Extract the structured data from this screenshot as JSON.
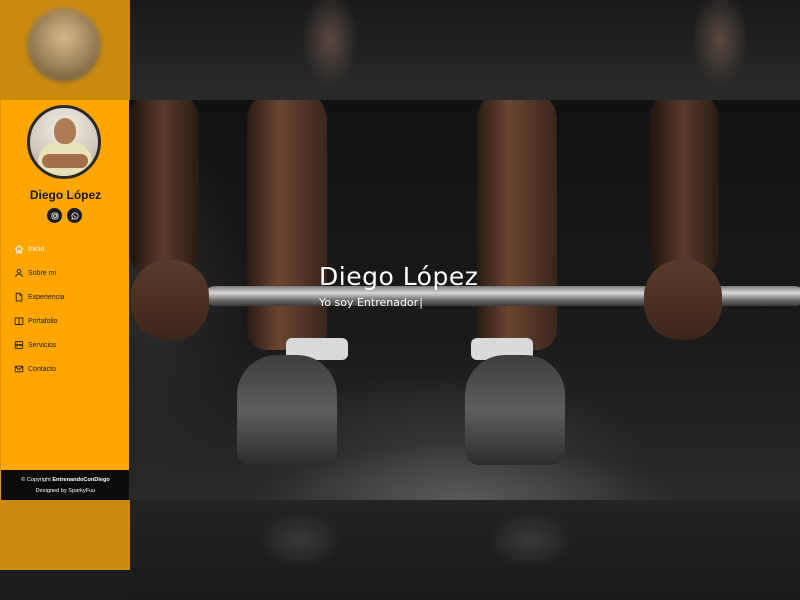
{
  "profile": {
    "name": "Diego López",
    "socials": [
      {
        "icon": "instagram-icon"
      },
      {
        "icon": "whatsapp-icon"
      }
    ]
  },
  "nav": {
    "items": [
      {
        "label": "Inicio",
        "icon": "home-icon",
        "active": true
      },
      {
        "label": "Sobre mi",
        "icon": "user-icon",
        "active": false
      },
      {
        "label": "Experiencia",
        "icon": "document-icon",
        "active": false
      },
      {
        "label": "Portafolio",
        "icon": "book-icon",
        "active": false
      },
      {
        "label": "Servicios",
        "icon": "server-icon",
        "active": false
      },
      {
        "label": "Contacto",
        "icon": "envelope-icon",
        "active": false
      }
    ]
  },
  "footer": {
    "copyright_prefix": "© Copyright ",
    "brand": "EntrenandoConDiego",
    "designed_by": "Designed by SparkyFuu"
  },
  "hero": {
    "title": "Diego López",
    "subtitle_prefix": "Yo soy ",
    "subtitle_typed": "Entrenador",
    "cursor": "|"
  },
  "colors": {
    "accent": "#ffa600",
    "sidebar_text": "#1d1d1d",
    "footer_bg": "#0b0b0b",
    "social_bg": "#1b1b1b"
  }
}
